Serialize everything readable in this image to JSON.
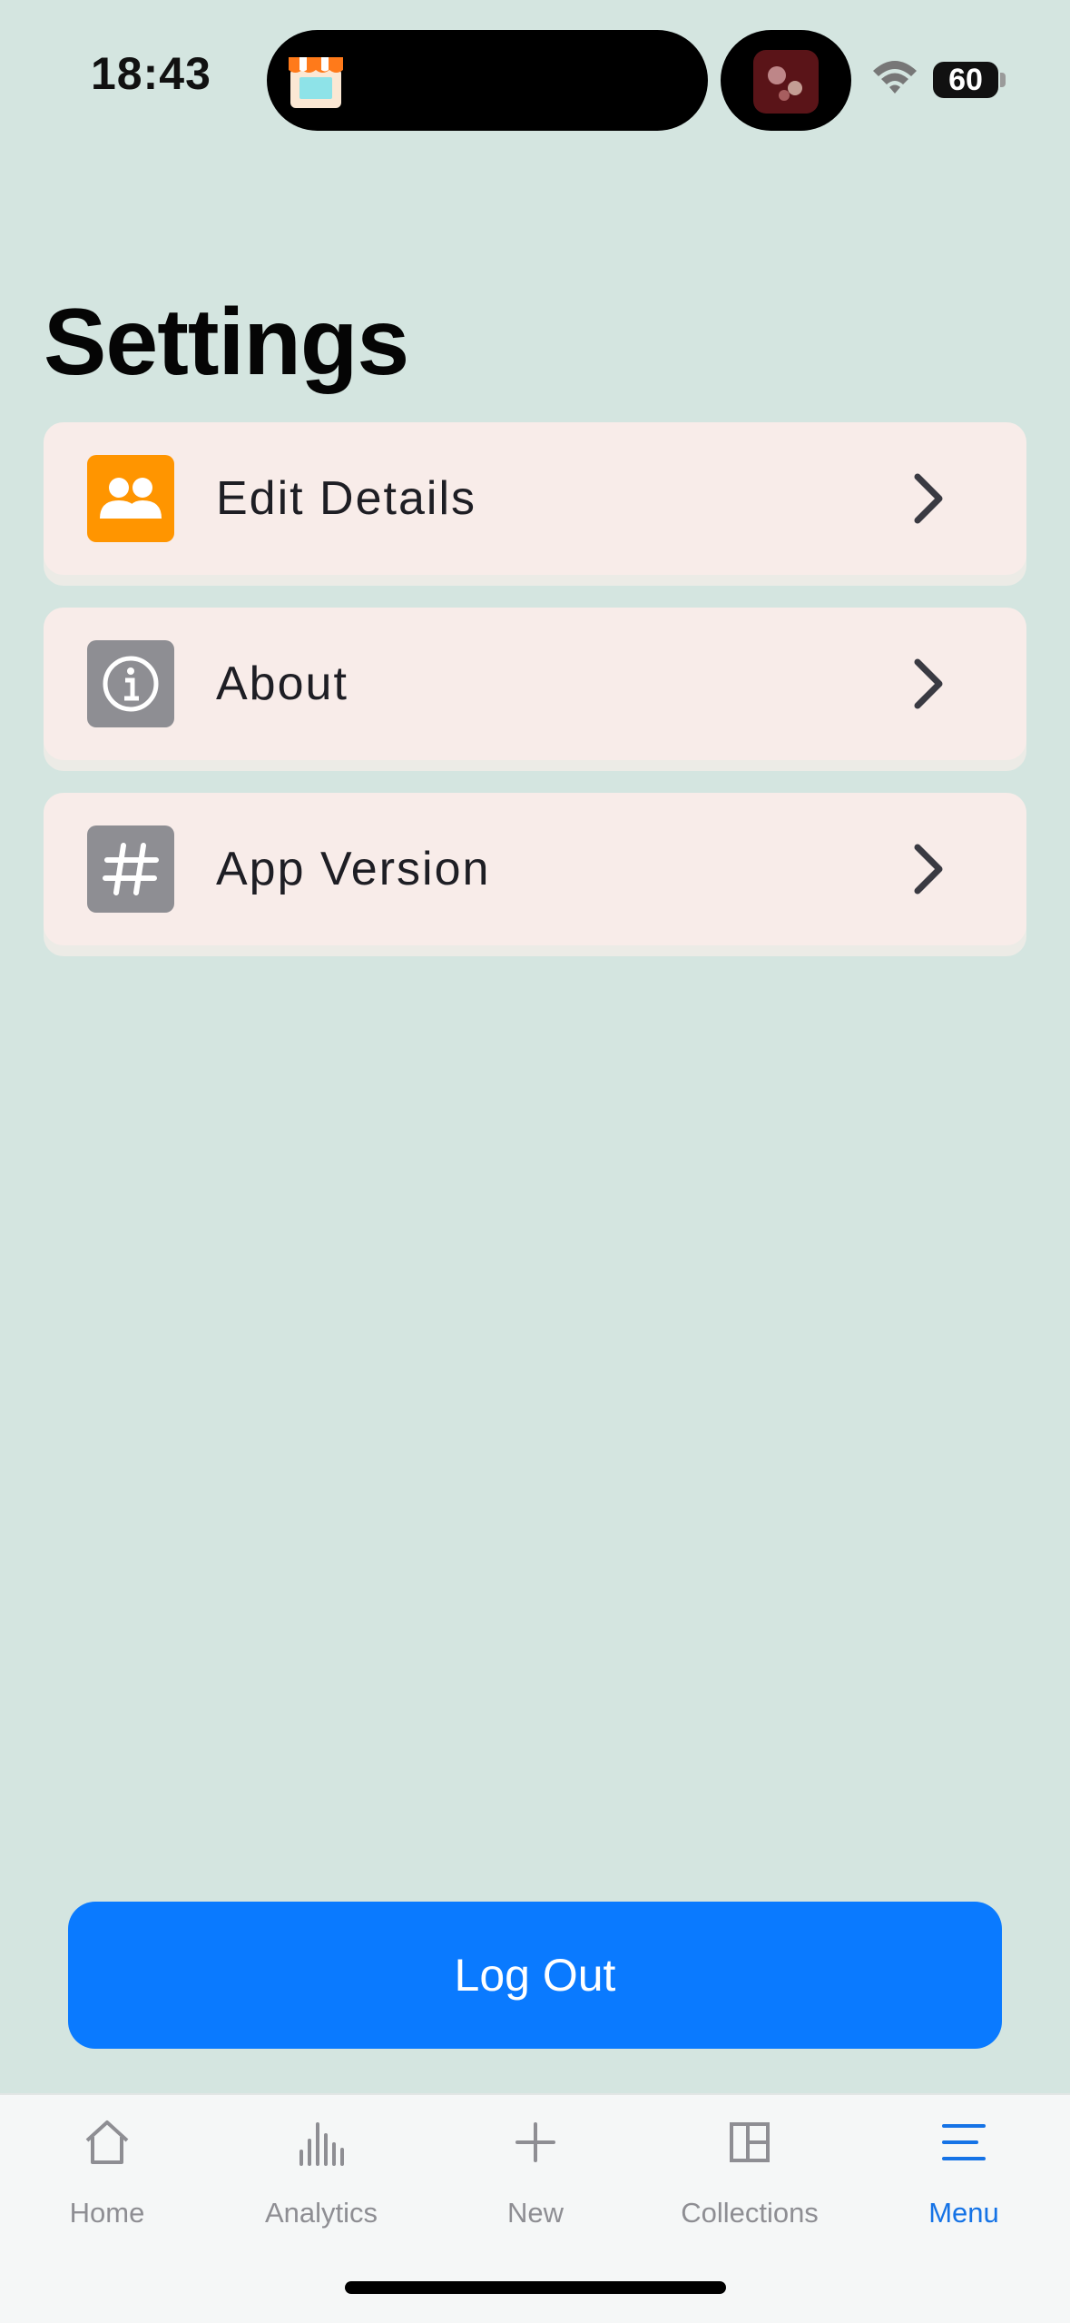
{
  "status_bar": {
    "time": "18:43",
    "battery": "60"
  },
  "page": {
    "title": "Settings"
  },
  "settings": {
    "items": [
      {
        "label": "Edit Details",
        "icon": "people-icon",
        "icon_color": "#ff9500"
      },
      {
        "label": "About",
        "icon": "info-icon",
        "icon_color": "#8e8e93"
      },
      {
        "label": "App Version",
        "icon": "hash-icon",
        "icon_color": "#8e8e93"
      }
    ]
  },
  "logout": {
    "label": "Log Out",
    "color": "#0a7aff"
  },
  "tab_bar": {
    "tabs": [
      {
        "label": "Home",
        "icon": "home-icon"
      },
      {
        "label": "Analytics",
        "icon": "chart-icon"
      },
      {
        "label": "New",
        "icon": "plus-icon"
      },
      {
        "label": "Collections",
        "icon": "collections-icon"
      },
      {
        "label": "Menu",
        "icon": "menu-icon",
        "active": true
      }
    ],
    "active_color": "#1573e6",
    "inactive_color": "#8e8e93"
  }
}
